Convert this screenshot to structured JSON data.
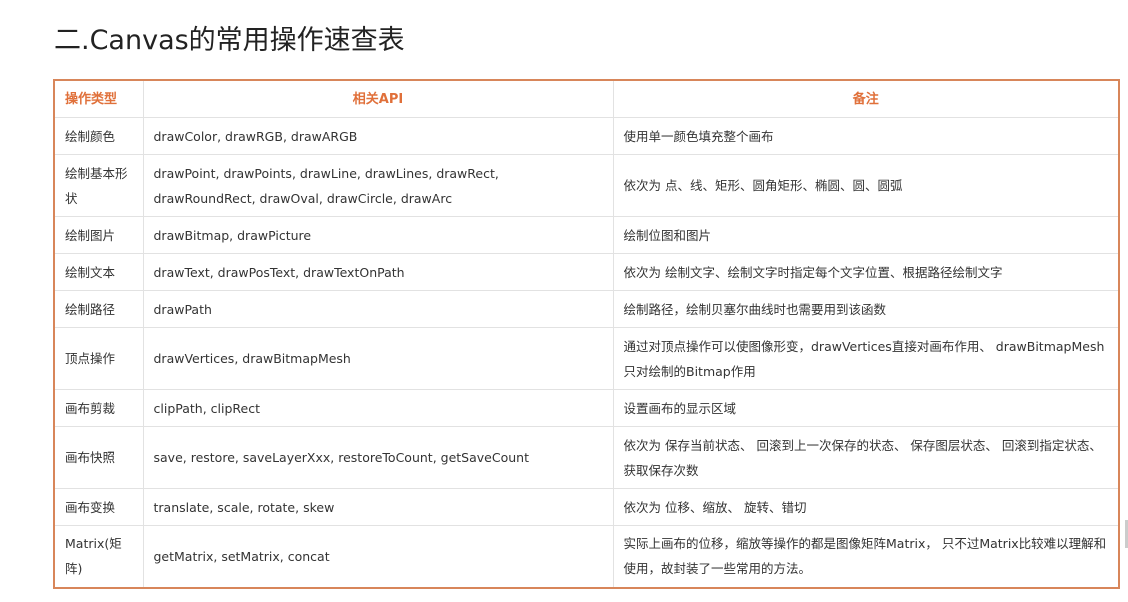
{
  "heading": "二.Canvas的常用操作速查表",
  "table": {
    "headers": {
      "type": "操作类型",
      "api": "相关API",
      "note": "备注"
    },
    "rows": [
      {
        "type": "绘制颜色",
        "api": "drawColor, drawRGB, drawARGB",
        "note": "使用单一颜色填充整个画布"
      },
      {
        "type": "绘制基本形状",
        "api": "drawPoint, drawPoints, drawLine, drawLines, drawRect, drawRoundRect, drawOval, drawCircle, drawArc",
        "note": "依次为 点、线、矩形、圆角矩形、椭圆、圆、圆弧"
      },
      {
        "type": "绘制图片",
        "api": "drawBitmap, drawPicture",
        "note": "绘制位图和图片"
      },
      {
        "type": "绘制文本",
        "api": "drawText, drawPosText, drawTextOnPath",
        "note": "依次为 绘制文字、绘制文字时指定每个文字位置、根据路径绘制文字"
      },
      {
        "type": "绘制路径",
        "api": "drawPath",
        "note": "绘制路径，绘制贝塞尔曲线时也需要用到该函数"
      },
      {
        "type": "顶点操作",
        "api": "drawVertices, drawBitmapMesh",
        "note": "通过对顶点操作可以使图像形变，drawVertices直接对画布作用、 drawBitmapMesh只对绘制的Bitmap作用"
      },
      {
        "type": "画布剪裁",
        "api": "clipPath, clipRect",
        "note": "设置画布的显示区域"
      },
      {
        "type": "画布快照",
        "api": "save, restore, saveLayerXxx, restoreToCount, getSaveCount",
        "note": "依次为 保存当前状态、 回滚到上一次保存的状态、 保存图层状态、 回滚到指定状态、 获取保存次数"
      },
      {
        "type": "画布变换",
        "api": "translate, scale, rotate, skew",
        "note": "依次为 位移、缩放、 旋转、错切"
      },
      {
        "type": "Matrix(矩阵)",
        "api": "getMatrix, setMatrix, concat",
        "note": "实际上画布的位移，缩放等操作的都是图像矩阵Matrix， 只不过Matrix比较难以理解和使用，故封装了一些常用的方法。"
      }
    ]
  },
  "colors": {
    "accent": "#e0703a",
    "table_border": "#d8865a",
    "grid": "#e2e2e2",
    "text": "#333333"
  }
}
